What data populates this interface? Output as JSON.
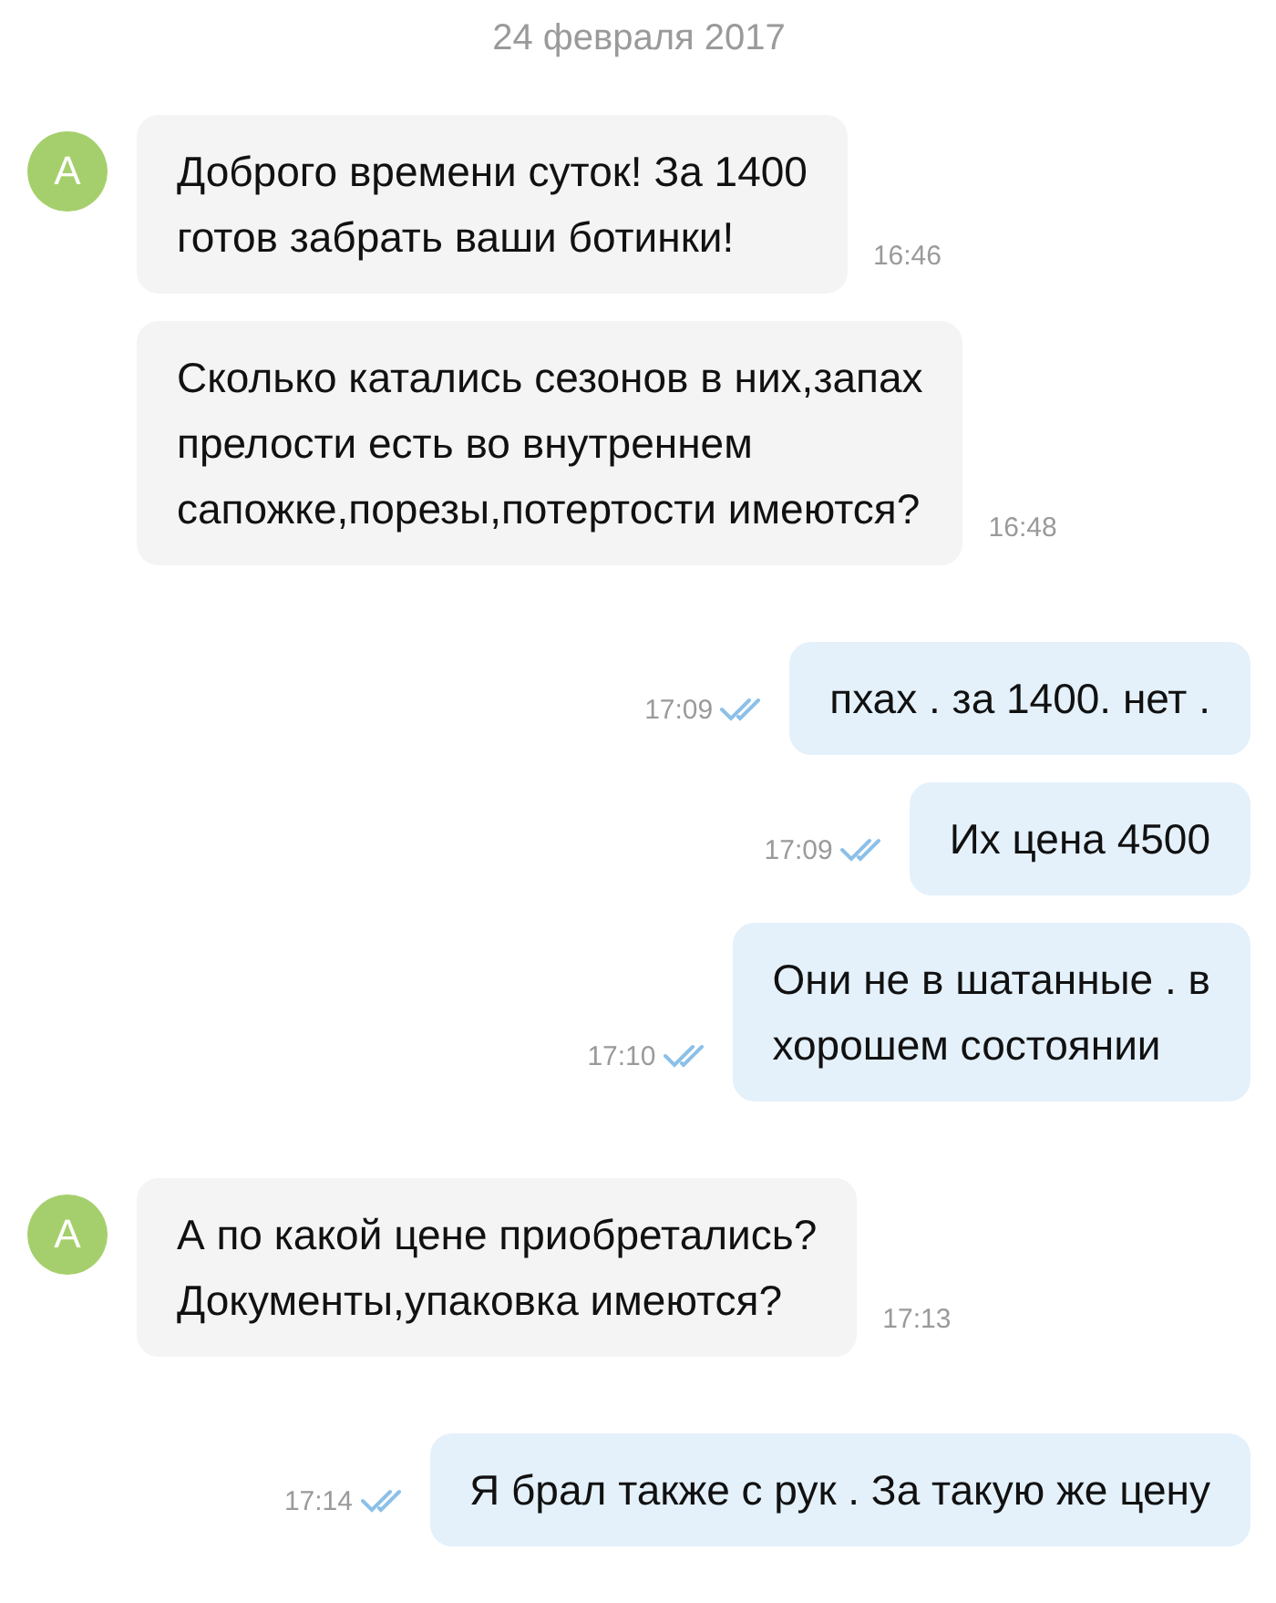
{
  "date": "24 февраля 2017",
  "messages": [
    {
      "kind": "incoming",
      "avatar": "А",
      "text": "Доброго времени суток! За 1400\nготов забрать ваши ботинки!",
      "time": "16:46"
    },
    {
      "kind": "incoming",
      "text": "Сколько катались сезонов в них,запах\nпрелости есть во внутреннем\nсапожке,порезы,потертости имеются?",
      "time": "16:48"
    },
    {
      "kind": "outgoing",
      "text": "пхах . за 1400. нет .",
      "time": "17:09",
      "read": true
    },
    {
      "kind": "outgoing",
      "text": "Их цена 4500",
      "time": "17:09",
      "read": true
    },
    {
      "kind": "outgoing",
      "text": "Они не в шатанные . в\nхорошем состоянии",
      "time": "17:10",
      "read": true
    },
    {
      "kind": "incoming",
      "avatar": "А",
      "text": "А по какой цене приобретались?\nДокументы,упаковка имеются?",
      "time": "17:13"
    },
    {
      "kind": "outgoing",
      "text": "Я брал также с рук . За такую же цену",
      "time": "17:14",
      "read": true
    }
  ]
}
